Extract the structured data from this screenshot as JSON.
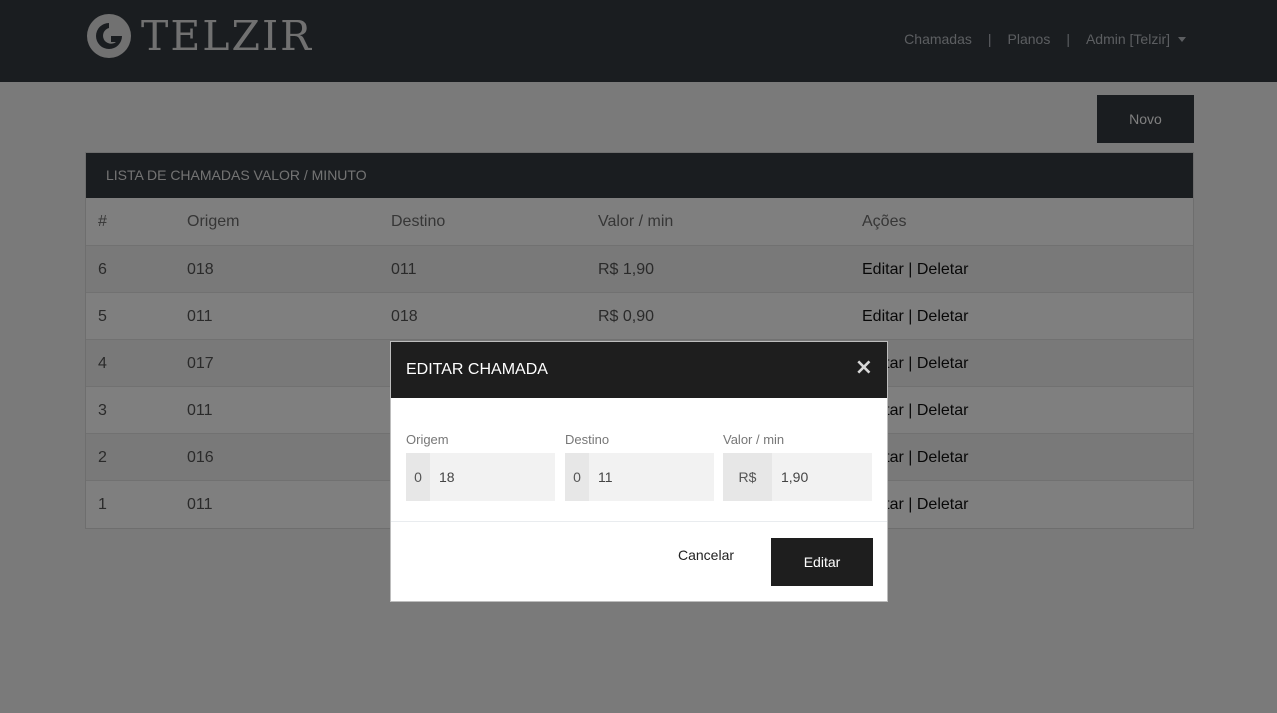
{
  "brand": {
    "name": "TELZIR"
  },
  "nav": {
    "links": [
      "Chamadas",
      "Planos"
    ],
    "separator": "|",
    "user": "Admin [Telzir]"
  },
  "toolbar": {
    "new_label": "Novo"
  },
  "list": {
    "title": "LISTA DE CHAMADAS VALOR / MINUTO",
    "columns": [
      "#",
      "Origem",
      "Destino",
      "Valor / min",
      "Ações"
    ],
    "rows": [
      {
        "id": "6",
        "origem": "018",
        "destino": "011",
        "valor": "R$ 1,90"
      },
      {
        "id": "5",
        "origem": "011",
        "destino": "018",
        "valor": "R$ 0,90"
      },
      {
        "id": "4",
        "origem": "017",
        "destino": "",
        "valor": ""
      },
      {
        "id": "3",
        "origem": "011",
        "destino": "",
        "valor": ""
      },
      {
        "id": "2",
        "origem": "016",
        "destino": "",
        "valor": ""
      },
      {
        "id": "1",
        "origem": "011",
        "destino": "",
        "valor": ""
      }
    ],
    "action_edit": "Editar",
    "action_delete": "Deletar",
    "action_sep": "|"
  },
  "modal": {
    "title": "EDITAR CHAMADA",
    "close": "×",
    "fields": {
      "origem": {
        "label": "Origem",
        "prefix": "0",
        "value": "18"
      },
      "destino": {
        "label": "Destino",
        "prefix": "0",
        "value": "11"
      },
      "valor": {
        "label": "Valor / min",
        "prefix": "R$",
        "value": "1,90"
      }
    },
    "cancel_label": "Cancelar",
    "submit_label": "Editar"
  },
  "colors": {
    "navbar": "#343a40",
    "modal_header": "#1e1e1e",
    "overlay": "rgba(0,0,0,0.5)"
  }
}
